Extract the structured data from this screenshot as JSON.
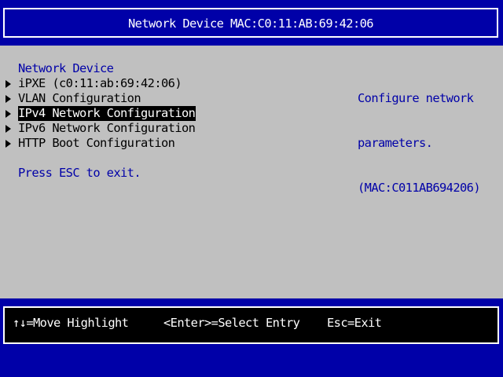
{
  "header": {
    "title": "Network Device MAC:C0:11:AB:69:42:06"
  },
  "form": {
    "title": "Network Device",
    "items": [
      {
        "label": "iPXE (c0:11:ab:69:42:06)",
        "selected": false
      },
      {
        "label": "VLAN Configuration",
        "selected": false
      },
      {
        "label": "IPv4 Network Configuration",
        "selected": true
      },
      {
        "label": "IPv6 Network Configuration",
        "selected": false
      },
      {
        "label": "HTTP Boot Configuration",
        "selected": false
      }
    ],
    "hint": "Press ESC to exit."
  },
  "help": {
    "lines": [
      "Configure network",
      "parameters.",
      "(MAC:C011AB694206)"
    ]
  },
  "footer": {
    "move_highlight": "↑↓=Move Highlight",
    "select_entry": "<Enter>=Select Entry",
    "exit": "Esc=Exit"
  },
  "colors": {
    "background_blue": "#0000a8",
    "panel_gray": "#c0c0c0",
    "highlight_black": "#000000",
    "text_white": "#ffffff"
  }
}
